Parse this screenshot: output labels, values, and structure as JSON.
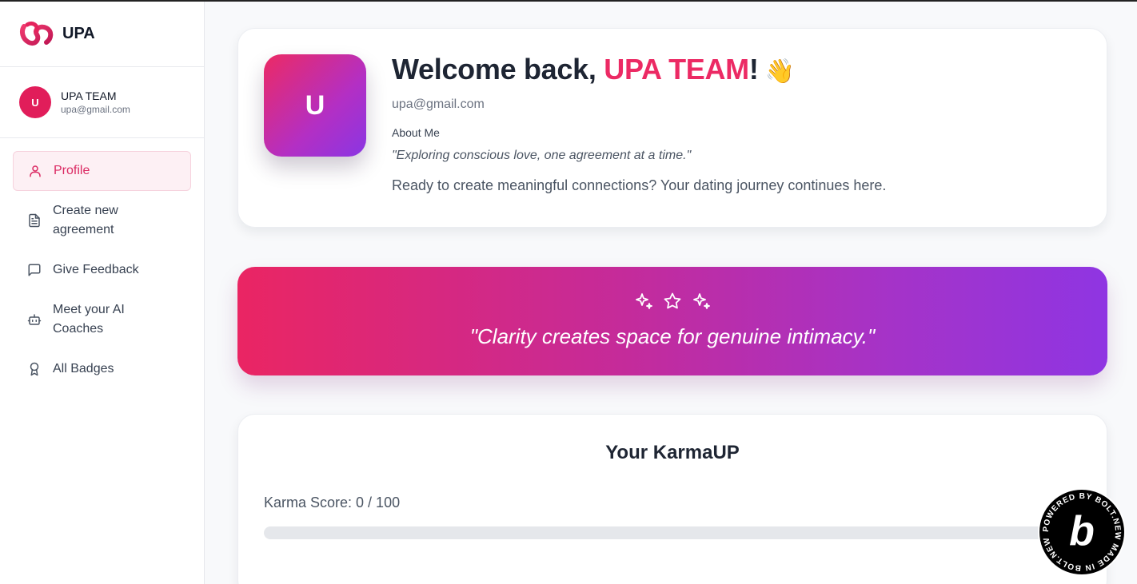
{
  "brand": {
    "name": "UPA"
  },
  "user": {
    "initial": "U",
    "name": "UPA TEAM",
    "email": "upa@gmail.com"
  },
  "nav": [
    {
      "label": "Profile",
      "icon": "user-icon",
      "active": true
    },
    {
      "label": "Create new agreement",
      "icon": "document-icon",
      "active": false
    },
    {
      "label": "Give Feedback",
      "icon": "message-square-icon",
      "active": false
    },
    {
      "label": "Meet your AI Coaches",
      "icon": "bot-icon",
      "active": false
    },
    {
      "label": "All Badges",
      "icon": "award-icon",
      "active": false
    }
  ],
  "profile": {
    "avatar_initial": "U",
    "welcome_prefix": "Welcome back, ",
    "welcome_name": "UPA TEAM",
    "welcome_suffix": "!",
    "wave_emoji": "👋",
    "email": "upa@gmail.com",
    "about_title": "About Me",
    "about_text": "\"Exploring conscious love, one agreement at a time.\"",
    "ready_text": "Ready to create meaningful connections? Your dating journey continues here."
  },
  "quote": {
    "icons": [
      "sparkles-icon",
      "star-icon",
      "sparkles-icon"
    ],
    "text": "\"Clarity creates space for genuine intimacy.\""
  },
  "karma": {
    "title": "Your KarmaUP",
    "score_label": "Karma Score: 0 / 100",
    "score": 0,
    "max": 100
  },
  "badge": {
    "text": "POWERED BY BOLT.NEW MADE IN BOLT.NEW"
  },
  "colors": {
    "accent": "#ec2a64",
    "gradient_start": "#ea2563",
    "gradient_end": "#8f35e2",
    "sidebar_active_bg": "#fdf0f4"
  }
}
